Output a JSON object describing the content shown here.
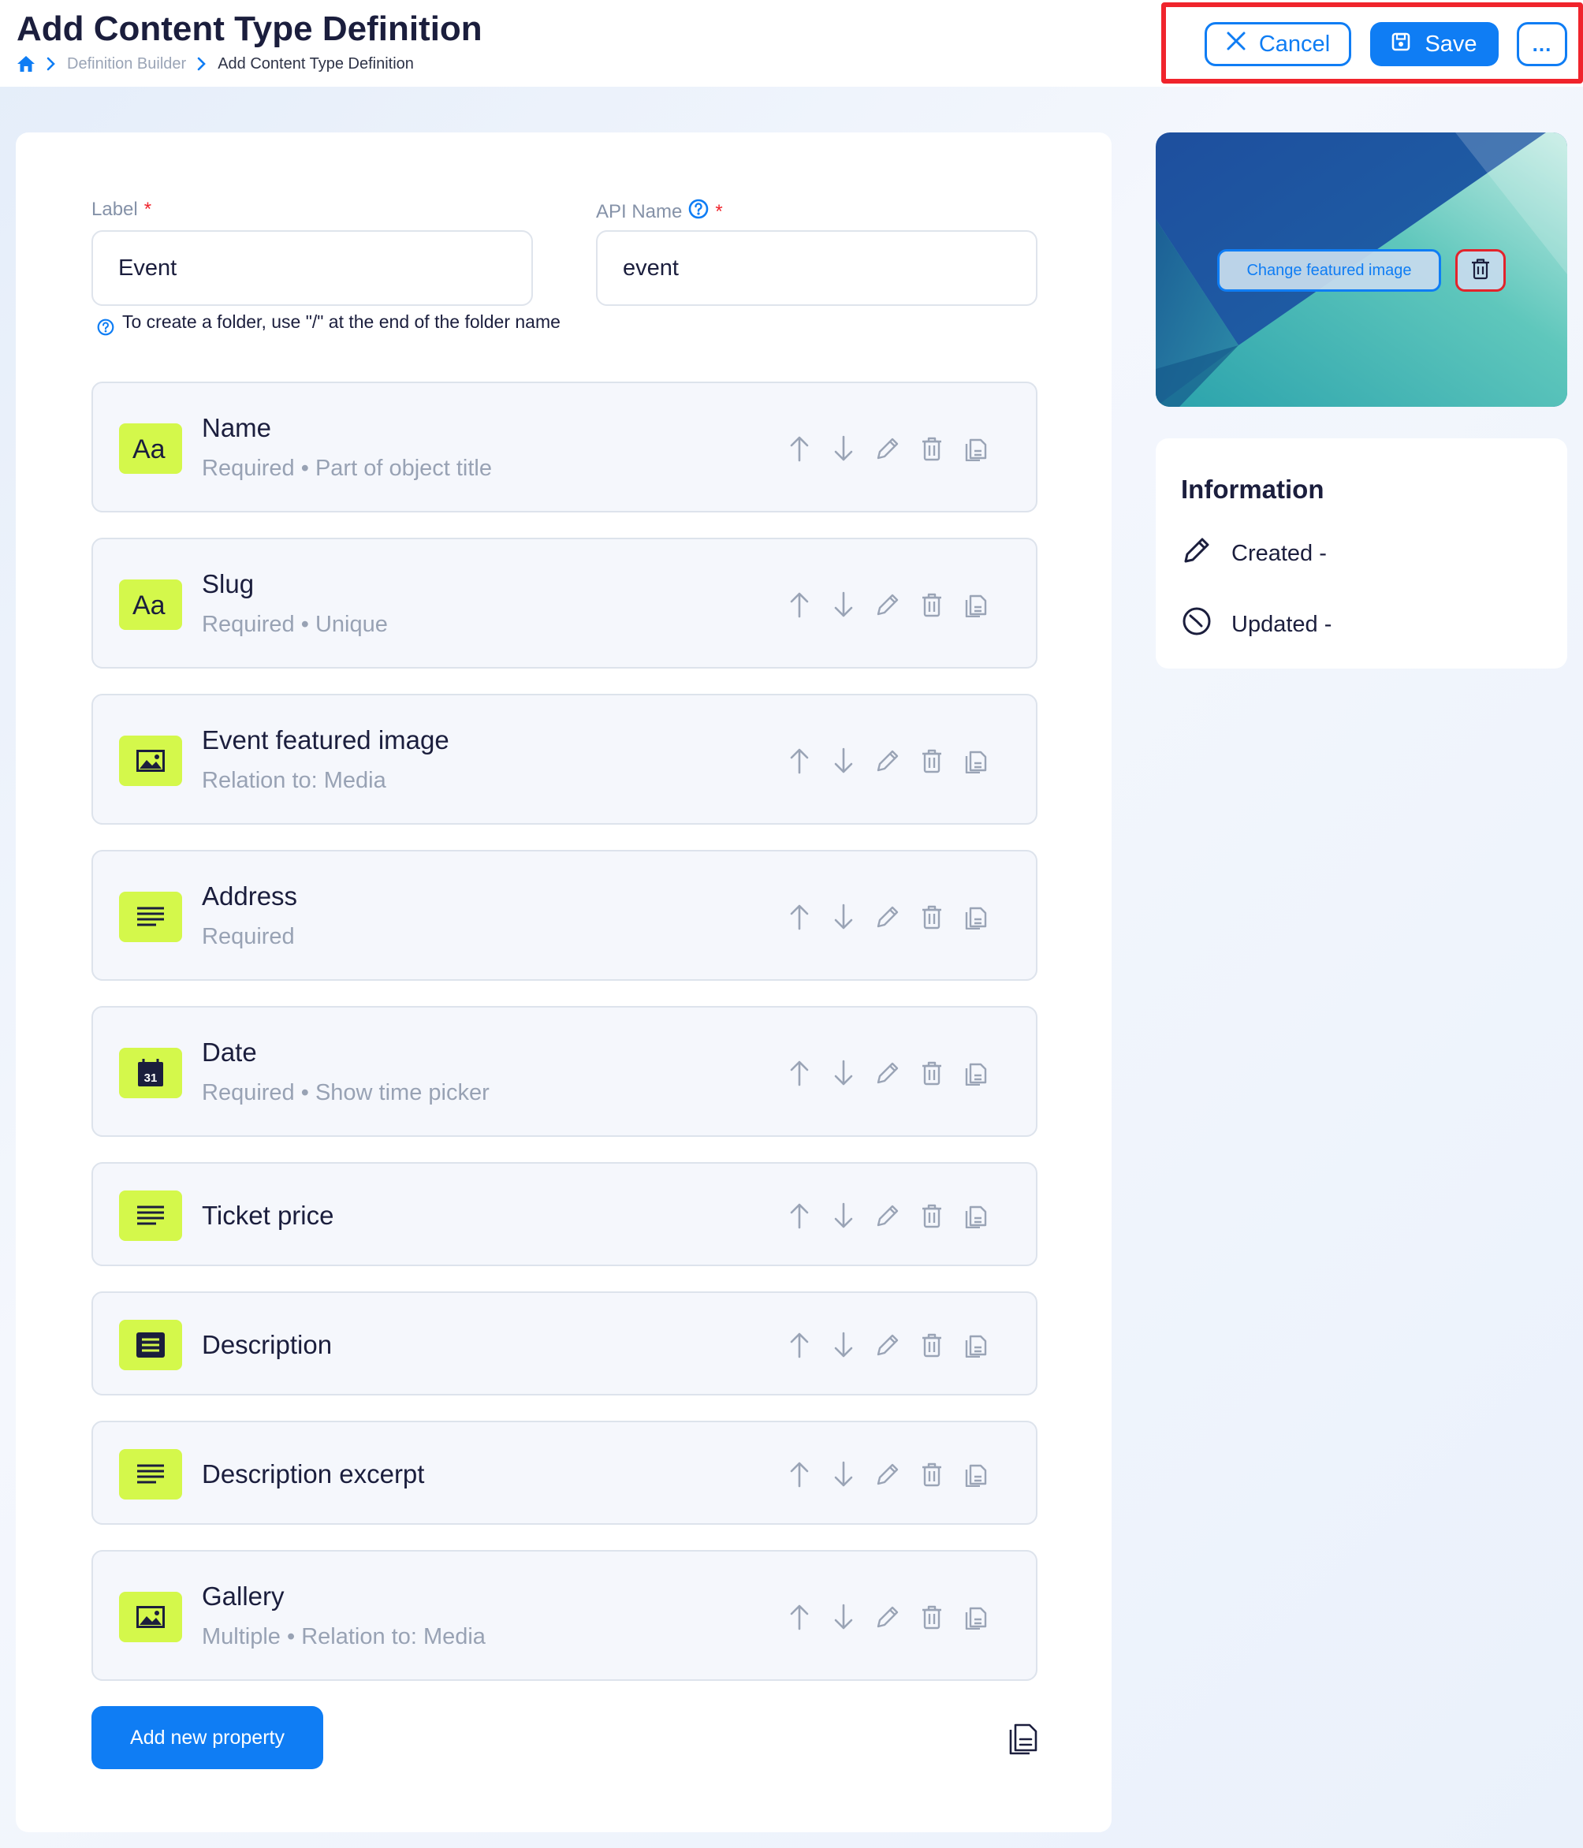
{
  "header": {
    "title": "Add Content Type Definition",
    "breadcrumb": {
      "home_icon": "home-icon",
      "parent": "Definition Builder",
      "current": "Add Content Type Definition"
    },
    "actions": {
      "cancel_label": "Cancel",
      "save_label": "Save",
      "more_label": "..."
    },
    "highlight_color": "#f0242c"
  },
  "form": {
    "label_field": {
      "label": "Label",
      "required_mark": "*",
      "value": "Event"
    },
    "api_name_field": {
      "label": "API Name",
      "required_mark": "*",
      "value": "event"
    },
    "hint": "To create a folder, use \"/\" at the end of the folder name"
  },
  "properties": [
    {
      "name": "Name",
      "meta": "Required • Part of object title",
      "icon": "text-aa-icon"
    },
    {
      "name": "Slug",
      "meta": "Required • Unique",
      "icon": "text-aa-icon"
    },
    {
      "name": "Event featured image",
      "meta": "Relation to: Media",
      "icon": "image-icon"
    },
    {
      "name": "Address",
      "meta": "Required",
      "icon": "lines-icon"
    },
    {
      "name": "Date",
      "meta": "Required • Show time picker",
      "icon": "calendar-icon"
    },
    {
      "name": "Ticket price",
      "meta": "",
      "icon": "lines-icon"
    },
    {
      "name": "Description",
      "meta": "",
      "icon": "rich-text-icon"
    },
    {
      "name": "Description excerpt",
      "meta": "",
      "icon": "lines-icon"
    },
    {
      "name": "Gallery",
      "meta": "Multiple • Relation to: Media",
      "icon": "image-icon"
    }
  ],
  "add_property_label": "Add new property",
  "featured_image": {
    "change_label": "Change featured image"
  },
  "information": {
    "title": "Information",
    "created_label": "Created",
    "created_value": "-",
    "updated_label": "Updated",
    "updated_value": "-"
  },
  "colors": {
    "accent": "#0f7df4",
    "chip": "#d4f84b",
    "danger": "#e3232b",
    "title": "#1b1e3d"
  }
}
